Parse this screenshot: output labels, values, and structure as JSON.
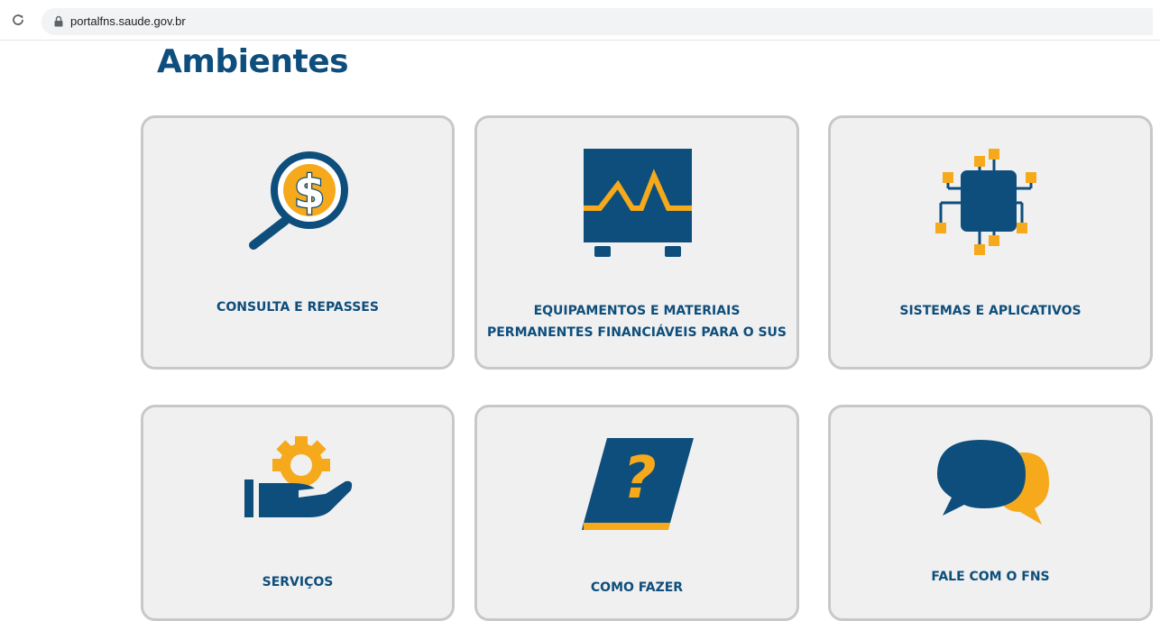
{
  "browser": {
    "url": "portalfns.saude.gov.br",
    "reload_icon": "reload-icon",
    "lock_icon": "lock-icon"
  },
  "page": {
    "title": "Ambientes"
  },
  "cards": [
    {
      "label": "CONSULTA  E REPASSES",
      "icon": "money-search-icon"
    },
    {
      "label": "EQUIPAMENTOS E MATERIAIS\nPERMANENTES FINANCIÁVEIS PARA O SUS",
      "icon": "monitor-equipment-icon"
    },
    {
      "label": "SISTEMAS E APLICATIVOS",
      "icon": "chip-network-icon"
    },
    {
      "label": "SERVIÇOS",
      "icon": "hand-gear-icon"
    },
    {
      "label": "COMO FAZER",
      "icon": "question-book-icon"
    },
    {
      "label": "FALE COM O FNS",
      "icon": "chat-bubbles-icon"
    }
  ],
  "colors": {
    "primary": "#0e4e7c",
    "accent": "#f5a91b",
    "card_bg": "#f0f0f0",
    "card_border": "#c8c8c8"
  }
}
